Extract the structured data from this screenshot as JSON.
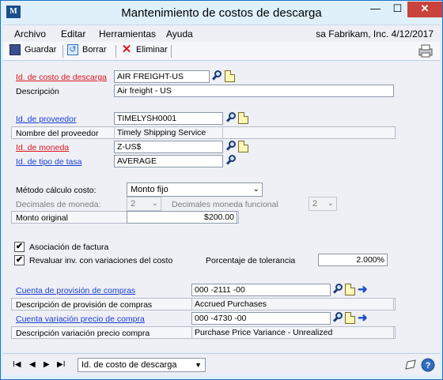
{
  "window": {
    "title": "Mantenimiento de costos de descarga",
    "app_icon": "gp-icon",
    "app_icon_text": "M"
  },
  "menu": {
    "items": [
      "Archivo",
      "Editar",
      "Herramientas",
      "Ayuda"
    ],
    "company": "sa  Fabrikam, Inc.  4/12/2017"
  },
  "toolbar": {
    "save": "Guardar",
    "clear": "Borrar",
    "delete": "Eliminar"
  },
  "form": {
    "landed_cost_id": {
      "label": "Id. de costo de descarga",
      "value": "AIR FREIGHT-US"
    },
    "description": {
      "label": "Descripción",
      "value": "Air freight - US"
    },
    "vendor_id": {
      "label": "Id. de proveedor",
      "value": "TIMELYSH0001"
    },
    "vendor_name": {
      "label": "Nombre del proveedor",
      "value": "Timely Shipping Service"
    },
    "currency_id": {
      "label": "Id. de moneda",
      "value": "Z-US$"
    },
    "rate_type_id": {
      "label": "Id. de tipo de tasa",
      "value": "AVERAGE"
    },
    "calc_method": {
      "label": "Método cálculo costo:",
      "value": "Monto fijo"
    },
    "currency_decimals": {
      "label": "Decimales de moneda:",
      "value": "2"
    },
    "functional_decimals": {
      "label": "Decimales moneda funcional",
      "value": "2"
    },
    "original_amount": {
      "label": "Monto original",
      "value": "$200.00"
    },
    "invoice_match": {
      "label": "Asociación de factura",
      "checked": true
    },
    "revalue": {
      "label": "Revaluar inv. con variaciones del costo",
      "checked": true
    },
    "tolerance": {
      "label": "Porcentaje de tolerancia",
      "value": "2.000%"
    },
    "accrual_account": {
      "label": "Cuenta de provisión de compras",
      "value": "000 -2111 -00"
    },
    "accrual_desc": {
      "label": "Descripción de provisión de compras",
      "value": "Accrued Purchases"
    },
    "ppv_account": {
      "label": "Cuenta variación precio de compra",
      "value": "000 -4730 -00"
    },
    "ppv_desc": {
      "label": "Descripción variación precio compra",
      "value": "Purchase Price Variance - Unrealized"
    }
  },
  "status": {
    "nav_first": "I◀",
    "nav_prev": "◀",
    "nav_next": "▶",
    "nav_last": "▶I",
    "sort_by": "Id. de costo de descarga"
  },
  "colors": {
    "required_label": "#e0141e",
    "link_label": "#1c3fd0",
    "title_bg": "#dff0fb",
    "close_button": "#c9433c"
  }
}
